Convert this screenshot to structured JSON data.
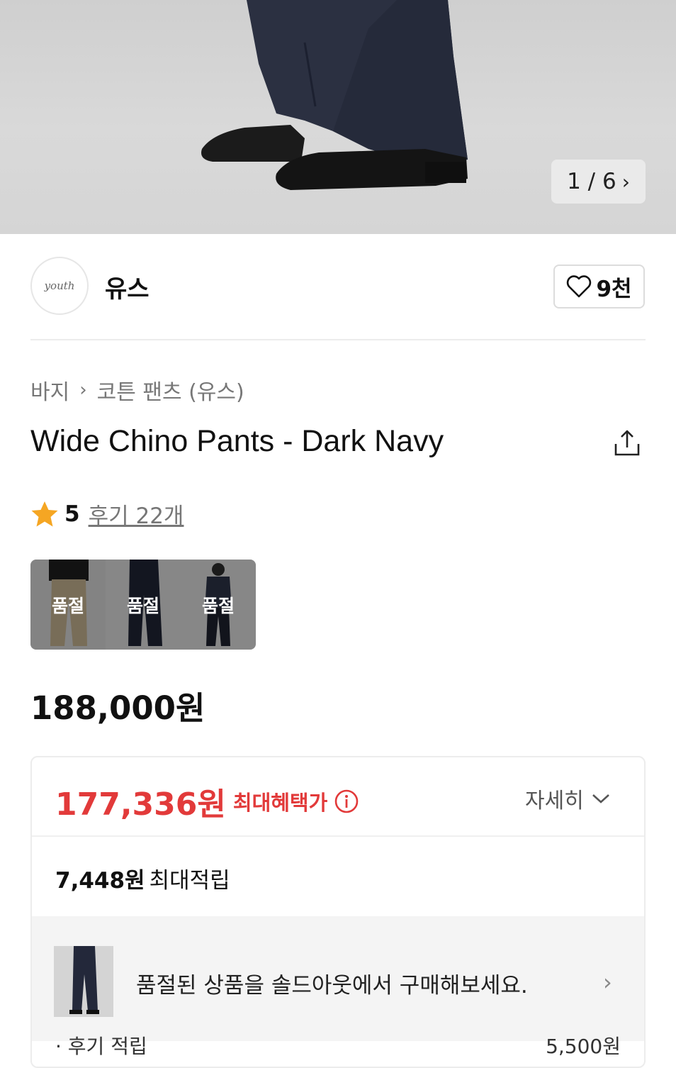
{
  "gallery": {
    "counter": "1 / 6",
    "next_icon": "chevron-right-icon"
  },
  "brand": {
    "logo_text": "youth",
    "name": "유스",
    "like_count": "9천"
  },
  "breadcrumb": {
    "category": "바지",
    "subcategory": "코튼 팬츠 (유스)"
  },
  "product": {
    "title": "Wide Chino Pants - Dark Navy"
  },
  "rating": {
    "score": "5",
    "review_link": "후기 22개"
  },
  "variants": [
    {
      "label": "품절",
      "color": "#b9a887"
    },
    {
      "label": "품절",
      "color": "#1e2332"
    },
    {
      "label": "품절",
      "color": "#2a3042"
    }
  ],
  "price": {
    "regular": "188,000원"
  },
  "benefit": {
    "max_price": "177,336원",
    "max_label": "최대혜택가",
    "detail_label": "자세히",
    "points": "7,448원",
    "points_label": "최대적립",
    "soldout_message": "품절된 상품을 솔드아웃에서 구매해보세요.",
    "cut_left": "· 후기 적립",
    "cut_right": "5,500원",
    "accent_color": "#e23a3a"
  }
}
